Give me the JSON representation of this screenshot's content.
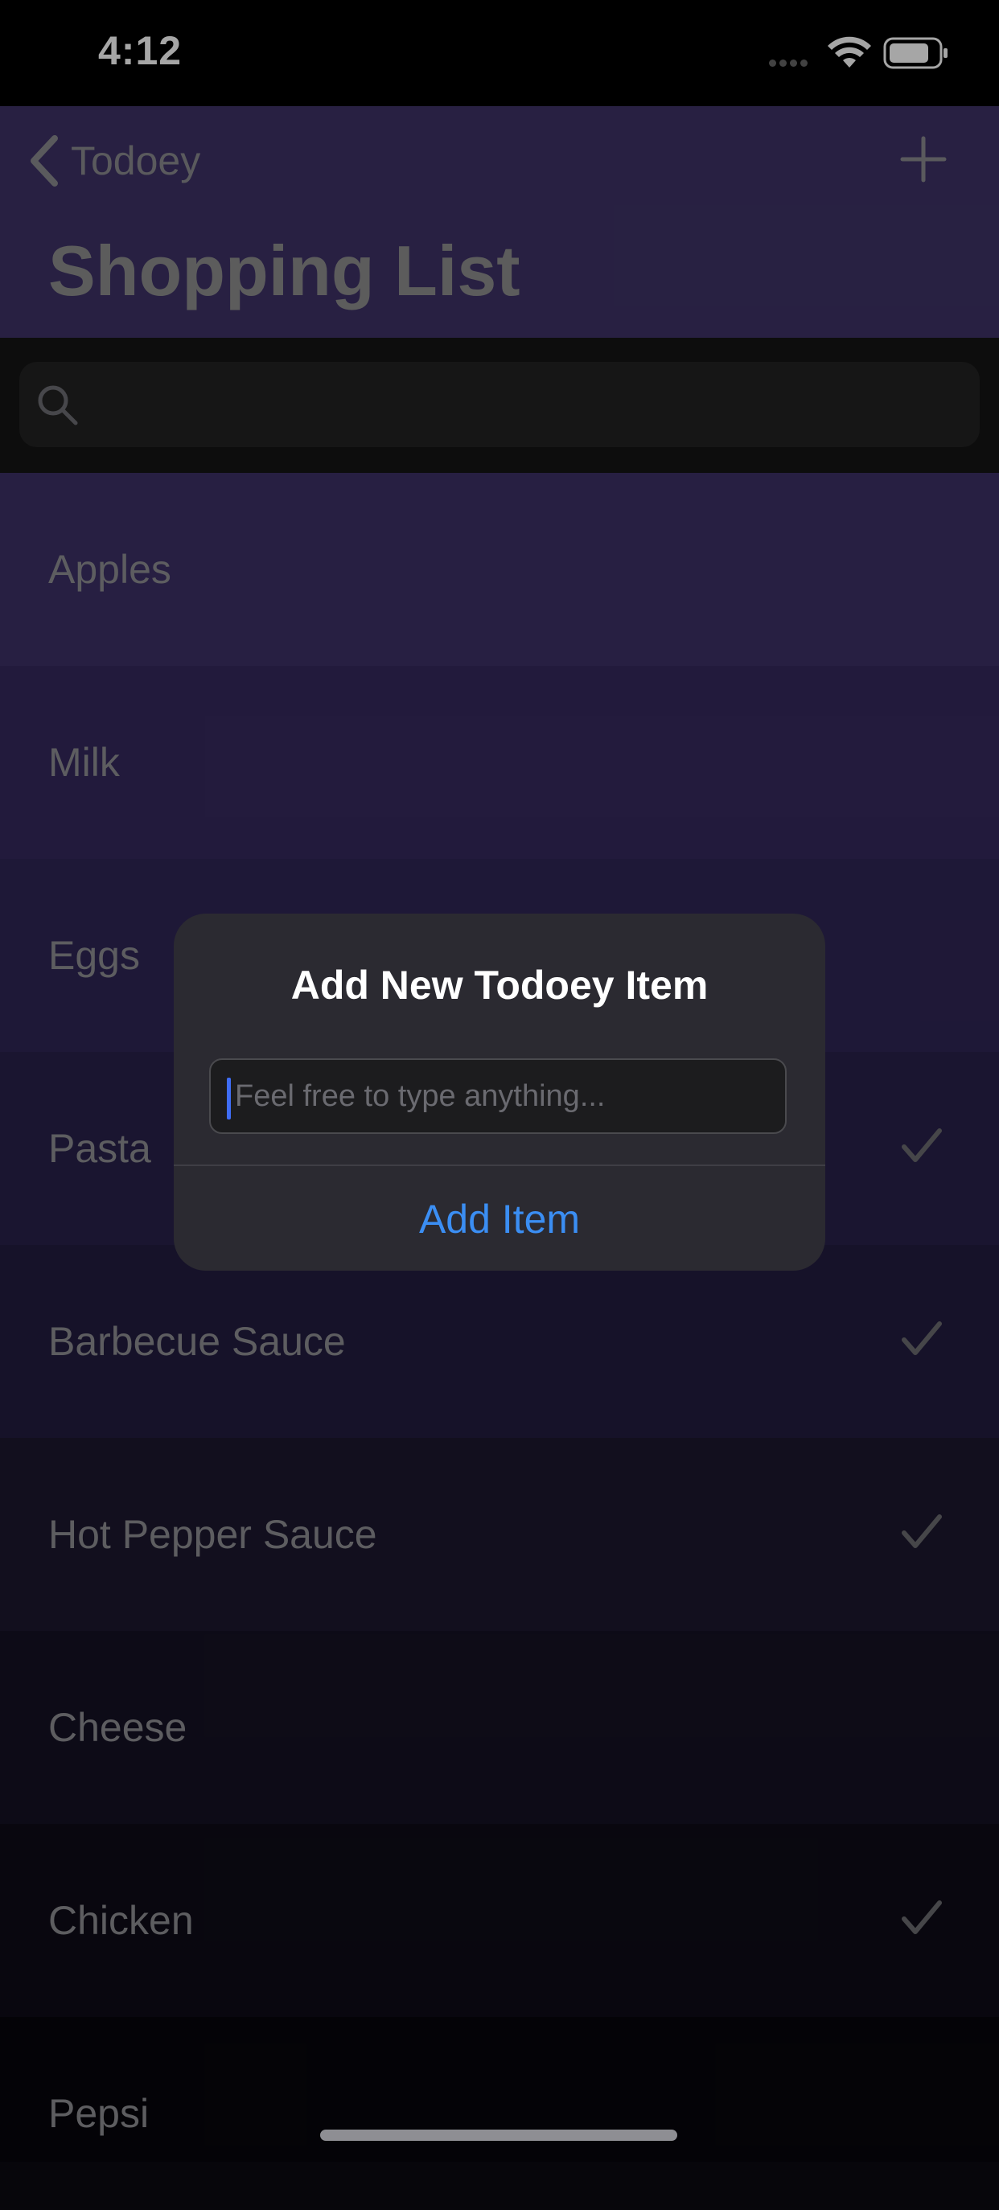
{
  "status_bar": {
    "time": "4:12"
  },
  "nav": {
    "back_label": "Todoey",
    "title": "Shopping List"
  },
  "search": {
    "placeholder": ""
  },
  "items": [
    {
      "label": "Apples",
      "done": false,
      "bg": "#3c3066"
    },
    {
      "label": "Milk",
      "done": false,
      "bg": "#35295d"
    },
    {
      "label": "Eggs",
      "done": false,
      "bg": "#2f2555"
    },
    {
      "label": "Pasta",
      "done": true,
      "bg": "#29214b"
    },
    {
      "label": "Barbecue Sauce",
      "done": true,
      "bg": "#221c3f"
    },
    {
      "label": "Hot Pepper Sauce",
      "done": true,
      "bg": "#1c172f"
    },
    {
      "label": "Cheese",
      "done": false,
      "bg": "#151224"
    },
    {
      "label": "Chicken",
      "done": true,
      "bg": "#0e0c17"
    },
    {
      "label": "Pepsi",
      "done": false,
      "bg": "#07060b"
    }
  ],
  "alert": {
    "title": "Add New Todoey Item",
    "input_placeholder": "Feel free to type anything...",
    "action_label": "Add Item"
  },
  "colors": {
    "nav_bg": "#3e3266",
    "accent": "#3b8ef3"
  }
}
